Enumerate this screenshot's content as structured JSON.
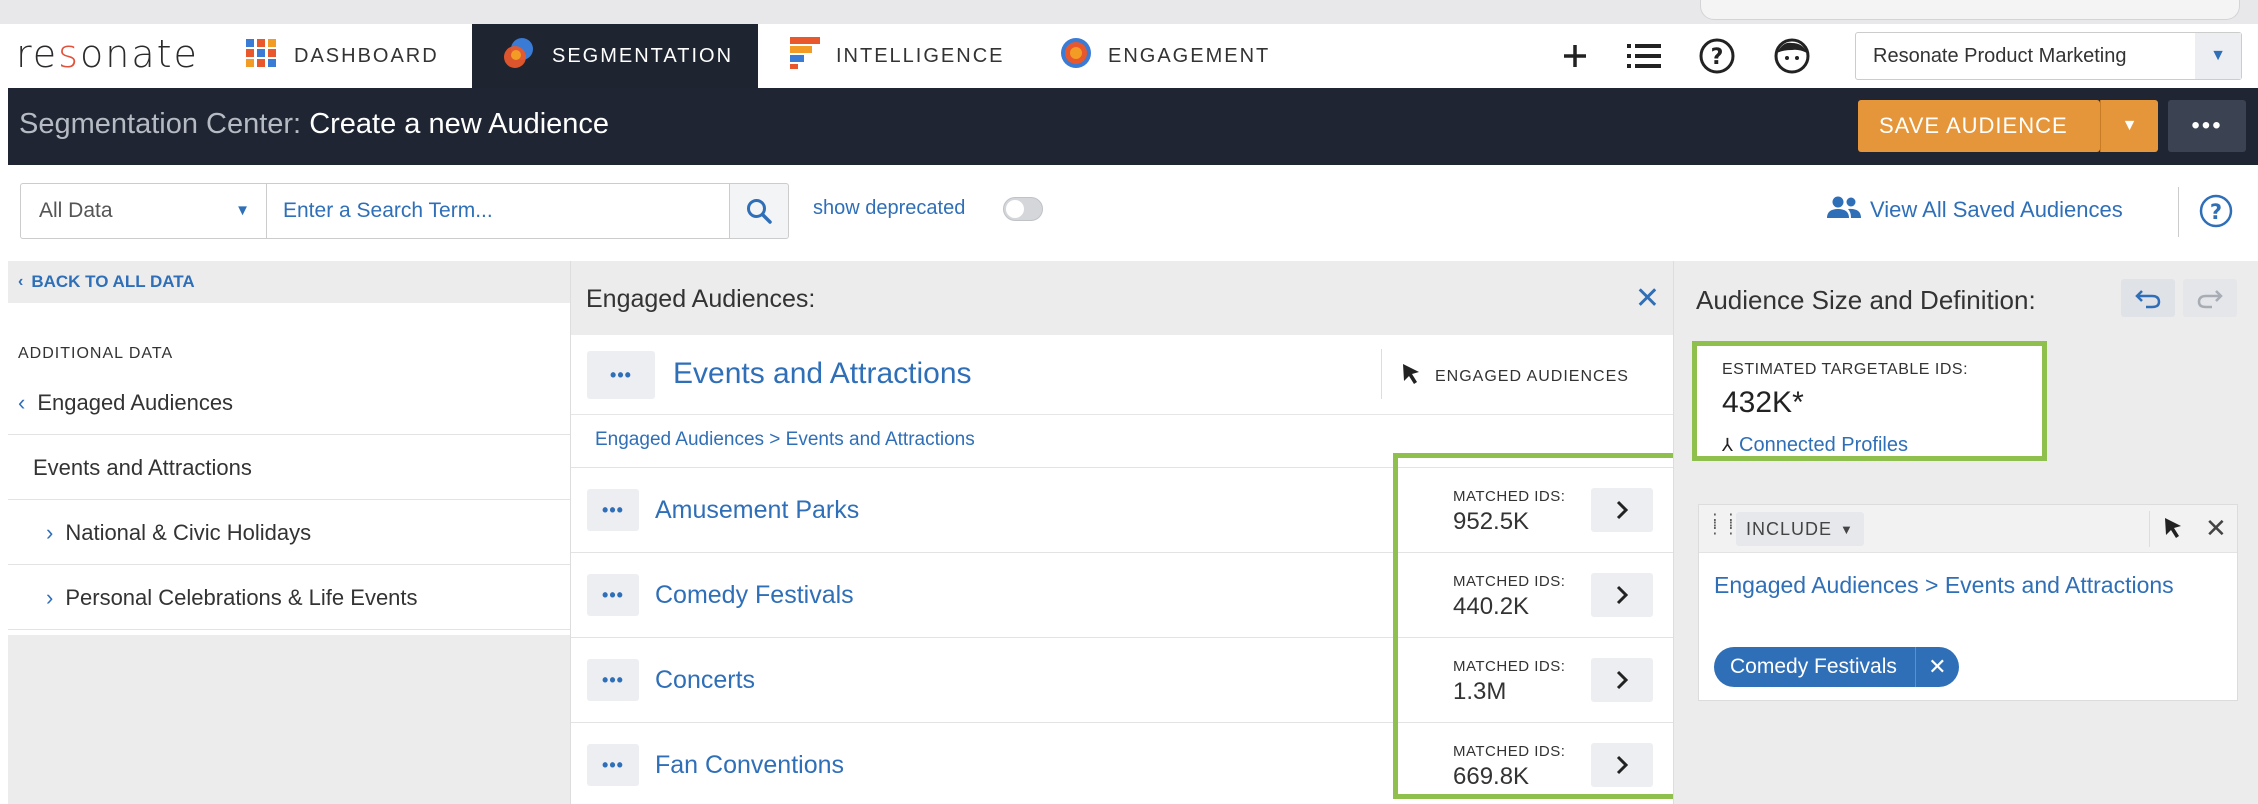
{
  "nav": {
    "logo_pre": "re",
    "logo_o": "s",
    "logo_post": "onate",
    "tabs": [
      {
        "label": "DASHBOARD",
        "icon": "dashboard-grid-icon"
      },
      {
        "label": "SEGMENTATION",
        "icon": "segmentation-icon",
        "active": true
      },
      {
        "label": "INTELLIGENCE",
        "icon": "intelligence-bars-icon"
      },
      {
        "label": "ENGAGEMENT",
        "icon": "engagement-target-icon"
      }
    ],
    "org": "Resonate Product Marketing"
  },
  "header": {
    "title_prefix": "Segmentation Center:",
    "title_main": "Create a new Audience",
    "save_label": "SAVE AUDIENCE"
  },
  "search": {
    "scope": "All Data",
    "placeholder": "Enter a Search Term...",
    "deprecated_label": "show deprecated",
    "view_saved": "View All Saved Audiences"
  },
  "left": {
    "back": "BACK TO ALL DATA",
    "section": "ADDITIONAL DATA",
    "items": [
      {
        "label": "Engaged Audiences"
      },
      {
        "label": "Events and Attractions"
      },
      {
        "label": "National & Civic Holidays"
      },
      {
        "label": "Personal Celebrations & Life Events"
      }
    ]
  },
  "middle": {
    "title": "Engaged Audiences:",
    "category": "Events and Attractions",
    "tag": "ENGAGED AUDIENCES",
    "breadcrumb": "Engaged Audiences > Events and Attractions",
    "matched_label": "MATCHED IDS:",
    "rows": [
      {
        "name": "Amusement Parks",
        "value": "952.5K"
      },
      {
        "name": "Comedy Festivals",
        "value": "440.2K"
      },
      {
        "name": "Concerts",
        "value": "1.3M"
      },
      {
        "name": "Fan Conventions",
        "value": "669.8K"
      }
    ]
  },
  "right": {
    "title": "Audience Size and Definition:",
    "est_label": "ESTIMATED TARGETABLE IDS:",
    "est_value": "432K*",
    "connected": "Connected Profiles",
    "include": "INCLUDE",
    "definition": "Engaged Audiences > Events and Attractions",
    "chip": "Comedy Festivals"
  },
  "colors": {
    "accent": "#2f6fb8",
    "header_bg": "#1f2532",
    "save": "#e6963a",
    "highlight": "#8fbf4d"
  }
}
